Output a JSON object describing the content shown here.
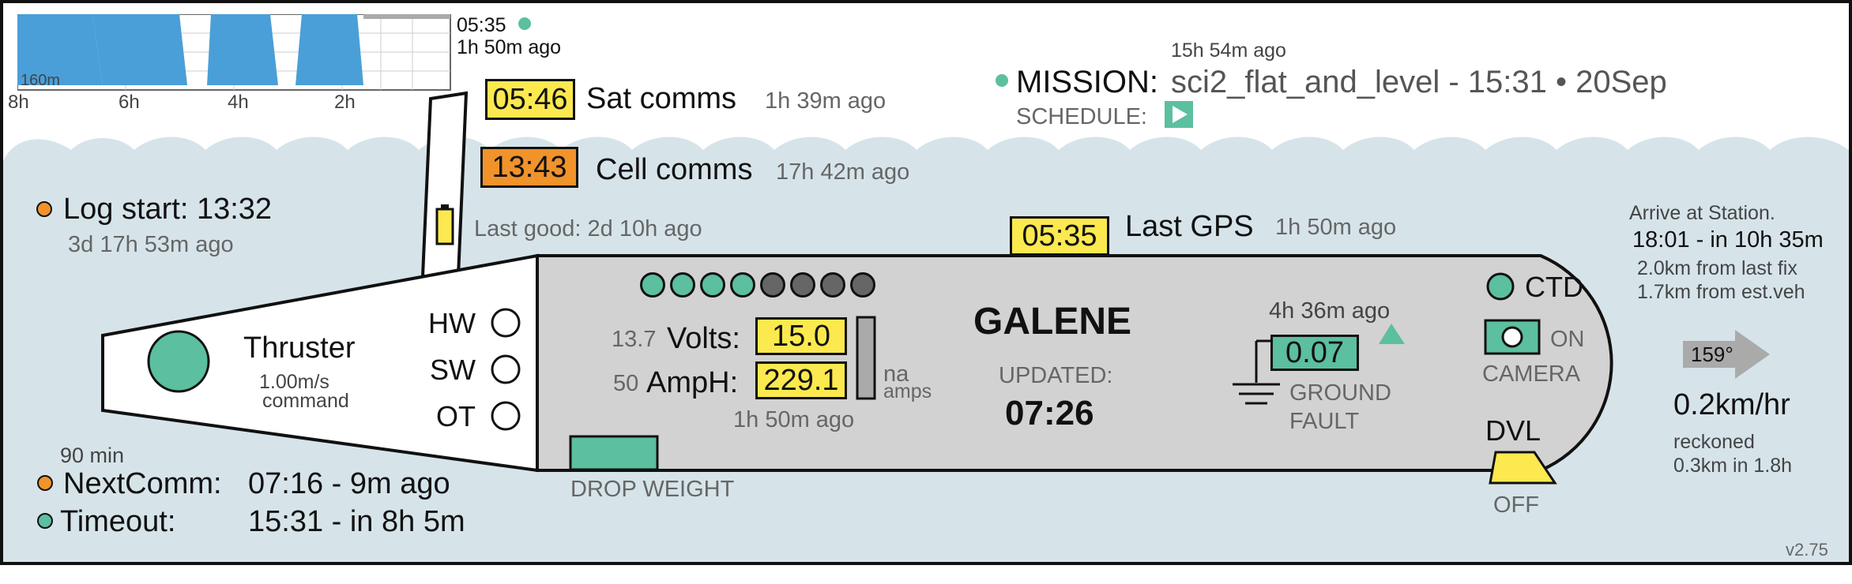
{
  "colors": {
    "green": "#5bbfa0",
    "yellow": "#fce94f",
    "orange": "#f0932b",
    "water": "#d6e4ea",
    "hull": "#d3d2d2",
    "plot_blue": "#4a9fd8"
  },
  "depth_plot": {
    "time": "05:35",
    "ago": "1h 50m ago",
    "depth_label": "160m",
    "x_ticks": [
      "8h",
      "6h",
      "4h",
      "2h"
    ]
  },
  "sat": {
    "time": "05:46",
    "label": "Sat comms",
    "ago": "1h 39m ago"
  },
  "cell": {
    "time": "13:43",
    "label": "Cell comms",
    "ago": "17h 42m ago"
  },
  "mission": {
    "ago": "15h 54m ago",
    "label": "MISSION:",
    "name": "sci2_flat_and_level - 15:31 • 20Sep",
    "schedule_label": "SCHEDULE:"
  },
  "log_start": {
    "label": "Log start: 13:32",
    "ago": "3d 17h 53m ago"
  },
  "last_good": "Last good: 2d 10h ago",
  "gps": {
    "time": "05:35",
    "label": "Last GPS",
    "ago": "1h 50m ago"
  },
  "arrive": {
    "title": "Arrive at Station.",
    "eta": "18:01 - in 10h 35m",
    "from_fix": "2.0km from last fix",
    "from_est": "1.7km from est.veh"
  },
  "thruster": {
    "label": "Thruster",
    "speed": "1.00m/s",
    "cmd": "command"
  },
  "switches": [
    "HW",
    "SW",
    "OT"
  ],
  "battery": {
    "volts_prev": "13.7",
    "volts_label": "Volts:",
    "volts": "15.0",
    "amph_prev": "50",
    "amph_label": "AmpH:",
    "amph": "229.1",
    "amps": "na",
    "amps_unit": "amps",
    "ago": "1h 50m ago",
    "cells_total": 8,
    "cells_ok": 4
  },
  "vehicle": {
    "name": "GALENE",
    "updated_label": "UPDATED:",
    "updated_time": "07:26"
  },
  "ground_fault": {
    "ago": "4h 36m ago",
    "value": "0.07",
    "label1": "GROUND",
    "label2": "FAULT"
  },
  "ctd": {
    "label": "CTD"
  },
  "camera": {
    "state": "ON",
    "label": "CAMERA"
  },
  "dvl": {
    "label": "DVL",
    "state": "OFF"
  },
  "drop_weight": "DROP WEIGHT",
  "heading": {
    "deg": "159°",
    "speed": "0.2km/hr",
    "reckoned": "reckoned",
    "dist": "0.3km in 1.8h"
  },
  "next_comm": {
    "interval": "90 min",
    "label": "NextComm:",
    "value": "07:16 - 9m ago"
  },
  "timeout": {
    "label": "Timeout:",
    "value": "15:31 - in 8h 5m"
  },
  "version": "v2.75"
}
